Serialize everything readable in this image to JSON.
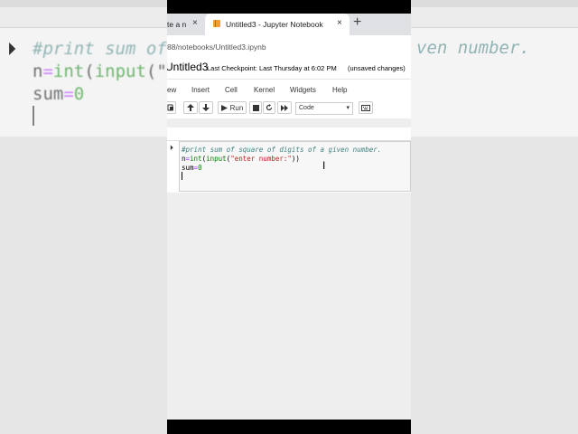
{
  "browser": {
    "tab1_title": "te a n",
    "tab2_title": "Untitled3 - Jupyter Notebook",
    "close_glyph": "×",
    "new_tab_glyph": "+",
    "url": "88/notebooks/Untitled3.ipynb"
  },
  "notebook": {
    "title": "Untitled3",
    "checkpoint": "Last Checkpoint: Last Thursday at 6:02 PM",
    "status": "(unsaved changes)"
  },
  "menu": [
    "ew",
    "Insert",
    "Cell",
    "Kernel",
    "Widgets",
    "Help"
  ],
  "toolbar": {
    "run_label": "Run",
    "cell_type": "Code"
  },
  "cell": {
    "comment": "#print sum of square of digits of a given number.",
    "line2": {
      "var": "n",
      "op": "=",
      "fn1": "int",
      "p1": "(",
      "fn2": "input",
      "p2": "(",
      "str": "\"enter number:\"",
      "p3": "))"
    },
    "line3": {
      "var": "sum",
      "op": "=",
      "num": "0"
    }
  },
  "background": {
    "left_comment": "#print sum of",
    "left_line2_fn": "int",
    "left_line2_fn2": "input",
    "left_line2_tail": "(\"e",
    "left_line3_var": "sum",
    "left_line3_num": "0",
    "right_tail": "ven number."
  },
  "colors": {
    "comment": "#408080",
    "builtin": "#008000",
    "operator": "#aa22ff",
    "string": "#ba2121"
  }
}
